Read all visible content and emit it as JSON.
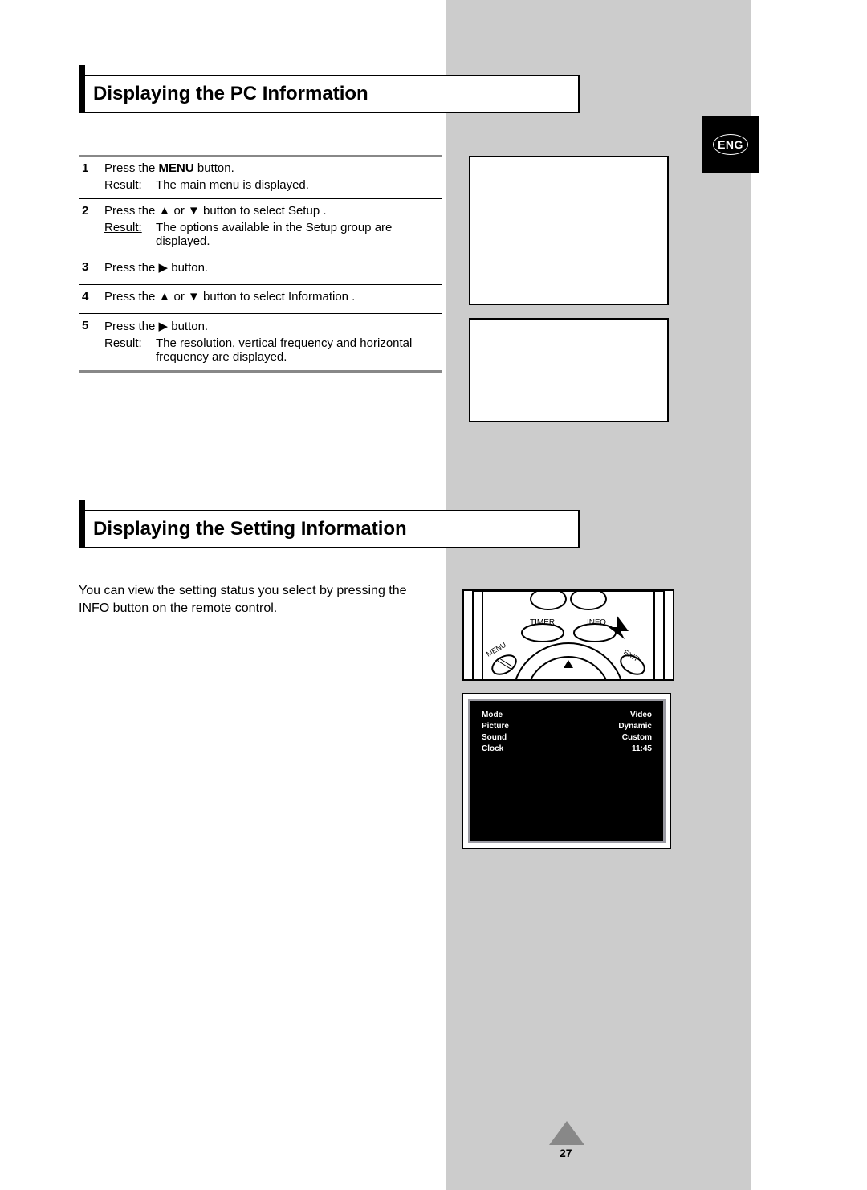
{
  "badge": {
    "text": "ENG"
  },
  "heading1": "Displaying the PC Information",
  "heading2": "Displaying the Setting Information",
  "steps": [
    {
      "num": "1",
      "line_parts": [
        "Press the ",
        "MENU",
        " button."
      ],
      "result_label": "Result:",
      "result": "The main menu is displayed."
    },
    {
      "num": "2",
      "line_parts": [
        "Press the ▲ or ▼ button to select Setup ."
      ],
      "result_label": "Result:",
      "result": "The options available in the Setup  group are displayed."
    },
    {
      "num": "3",
      "line_parts": [
        "Press the ▶ button."
      ]
    },
    {
      "num": "4",
      "line_parts": [
        "Press the ▲ or ▼ button to select Information     ."
      ]
    },
    {
      "num": "5",
      "line_parts": [
        "Press the ▶ button."
      ],
      "result_label": "Result:",
      "result": "The resolution, vertical frequency and horizontal frequency are displayed."
    }
  ],
  "intro": "You can view the setting status you select by pressing the  INFO button on the remote control.",
  "remote": {
    "timer": "TIMER",
    "info": "INFO",
    "menu": "MENU",
    "exit": "EXIT"
  },
  "osd": {
    "rows": [
      {
        "label": "Mode",
        "value": "Video"
      },
      {
        "label": "Picture",
        "value": "Dynamic"
      },
      {
        "label": "Sound",
        "value": "Custom"
      },
      {
        "label": "Clock",
        "value": "11:45"
      }
    ]
  },
  "page_number": "27"
}
